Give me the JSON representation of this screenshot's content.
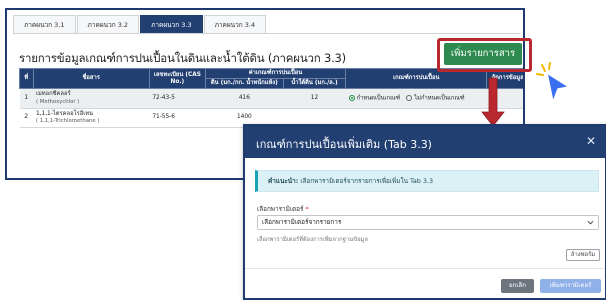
{
  "tabs": [
    {
      "label": "ภาคผนวก 3.1"
    },
    {
      "label": "ภาคผนวก 3.2"
    },
    {
      "label": "ภาคผนวก 3.3"
    },
    {
      "label": "ภาคผนวก 3.4"
    }
  ],
  "active_tab_index": 2,
  "section_title": "รายการข้อมูลเกณฑ์การปนเปื้อนในดินและน้ำใต้ดิน (ภาคผนวก 3.3)",
  "add_button_label": "เพิ่มรายการสาร",
  "table": {
    "headers": {
      "no": "ที่",
      "name": "ชื่อสาร",
      "cas": "เลขทะเบียน (CAS No.)",
      "group": "ค่าเกณฑ์การปนเปื้อน",
      "soil": "ดิน (มก./กก. น้ำหนักแห้ง)",
      "water": "น้ำใต้ดิน (มก./ล.)",
      "criteria": "เกณฑ์การปนเปื้อน",
      "manage": "จัดการข้อมูล"
    },
    "rows": [
      {
        "no": "1",
        "name": "เมทอกซีคลอร์",
        "name_en": "( Methoxychlor )",
        "cas": "72-43-5",
        "soil": "416",
        "water": "12",
        "opt_yes": "กำหนดเป็นเกณฑ์",
        "opt_no": "ไม่กำหนดเป็นเกณฑ์"
      },
      {
        "no": "2",
        "name": "1,1,1-ไตรคลอโรอีเทน",
        "name_en": "( 1,1,1-Trichloroethane )",
        "cas": "71-55-6",
        "soil": "1400",
        "water": "",
        "opt_yes": "",
        "opt_no": ""
      }
    ]
  },
  "modal": {
    "title": "เกณฑ์การปนเปื้อนเพิ่มเติม (Tab 3.3)",
    "close_symbol": "✕",
    "hint_label": "คำแนะนำ:",
    "hint_text": " เลือกพารามิเตอร์จากรายการเพื่อเพิ่มใน Tab 3.3",
    "field_label": "เลือกพารามิเตอร์",
    "required_mark": "*",
    "select_value": "เลือกพารามิเตอร์จากรายการ",
    "field_help": "เลือกพารามิเตอร์ที่ต้องการเพิ่มจากฐานข้อมูล",
    "clear_label": "ล้างฟอร์ม",
    "cancel_label": "ยกเลิก",
    "submit_label": "เพิ่มพารามิเตอร์"
  },
  "colors": {
    "navy": "#223f72",
    "green": "#2e8b4f",
    "callout_red": "#b8282e",
    "info_bg": "#dcf1f6",
    "submit_disabled": "#8fb0e8"
  },
  "icons": {
    "cursor": "pointer-cursor-icon",
    "arrow": "down-arrow-icon",
    "close": "close-icon",
    "chevron": "chevron-down-icon"
  }
}
